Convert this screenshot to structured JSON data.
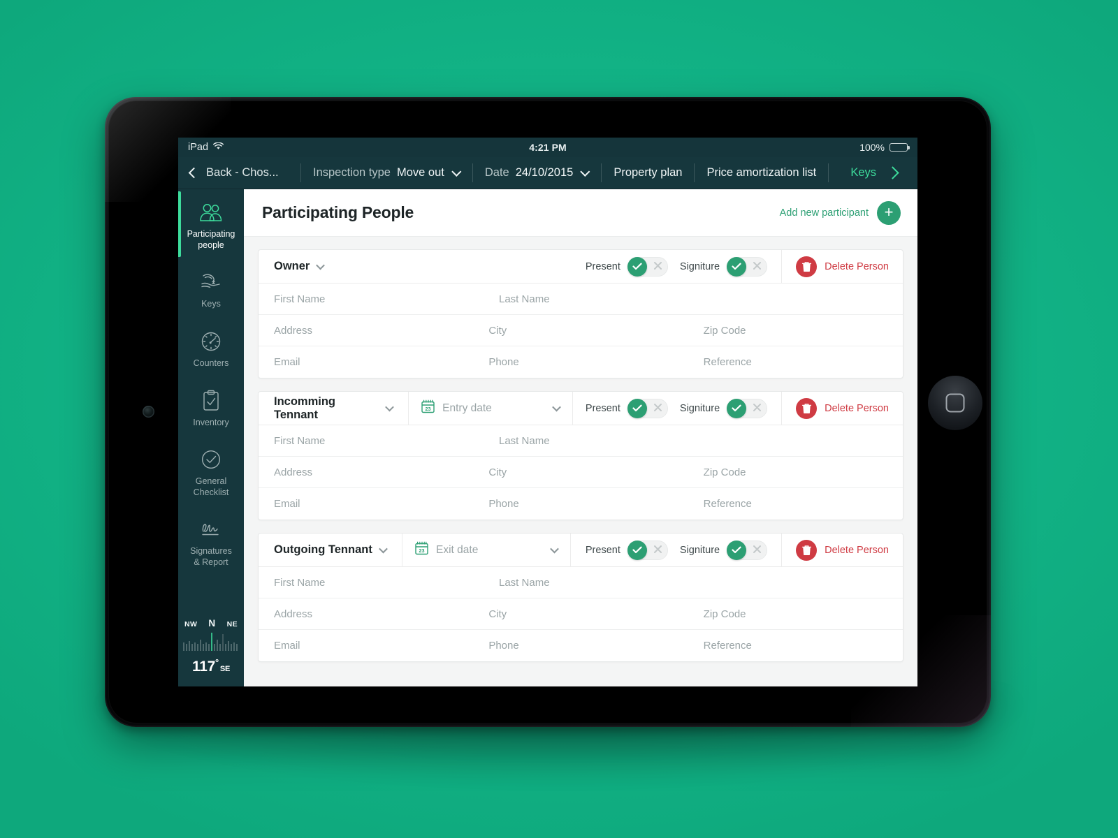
{
  "status_bar": {
    "device": "iPad",
    "wifi_icon": "wifi-icon",
    "time": "4:21 PM",
    "battery_percent": "100%"
  },
  "nav_bar": {
    "back_label": "Back - Chos...",
    "inspection_type_label": "Inspection type",
    "inspection_type_value": "Move out",
    "date_label": "Date",
    "date_value": "24/10/2015",
    "property_plan": "Property plan",
    "price_amortization": "Price amortization list",
    "keys_link": "Keys"
  },
  "sidebar": {
    "items": [
      {
        "label_line1": "Participating",
        "label_line2": "people",
        "icon": "people-icon",
        "active": true
      },
      {
        "label_line1": "Keys",
        "label_line2": "",
        "icon": "hand-key-icon",
        "active": false
      },
      {
        "label_line1": "Counters",
        "label_line2": "",
        "icon": "gauge-icon",
        "active": false
      },
      {
        "label_line1": "Inventory",
        "label_line2": "",
        "icon": "clipboard-check-icon",
        "active": false
      },
      {
        "label_line1": "General",
        "label_line2": "Checklist",
        "icon": "check-circle-icon",
        "active": false
      },
      {
        "label_line1": "Signatures",
        "label_line2": "& Report",
        "icon": "signature-icon",
        "active": false
      }
    ],
    "compass": {
      "left_dir": "NW",
      "center_dir": "N",
      "right_dir": "NE",
      "heading": "117",
      "degree_symbol": "°",
      "heading_dir": "SE"
    }
  },
  "main": {
    "title": "Participating People",
    "add_participant_label": "Add new participant",
    "add_participant_icon": "plus-icon",
    "present_label": "Present",
    "signature_label": "Signiture",
    "delete_label": "Delete Person",
    "cards": [
      {
        "role": "Owner",
        "has_date": false,
        "date_placeholder": "",
        "present_on": true,
        "signature_on": true,
        "rows": [
          [
            "First Name",
            "Last Name",
            ""
          ],
          [
            "Address",
            "City",
            "Zip Code"
          ],
          [
            "Email",
            "Phone",
            "Reference"
          ]
        ]
      },
      {
        "role": "Incomming Tennant",
        "has_date": true,
        "date_placeholder": "Entry date",
        "present_on": true,
        "signature_on": true,
        "rows": [
          [
            "First Name",
            "Last Name",
            ""
          ],
          [
            "Address",
            "City",
            "Zip Code"
          ],
          [
            "Email",
            "Phone",
            "Reference"
          ]
        ]
      },
      {
        "role": "Outgoing Tennant",
        "has_date": true,
        "date_placeholder": "Exit date",
        "present_on": true,
        "signature_on": true,
        "rows": [
          [
            "First Name",
            "Last Name",
            ""
          ],
          [
            "Address",
            "City",
            "Zip Code"
          ],
          [
            "Email",
            "Phone",
            "Reference"
          ]
        ]
      }
    ]
  },
  "colors": {
    "backdrop_green": "#12b386",
    "accent_green": "#2c9f73",
    "nav_dark": "#16373d",
    "active_indicator": "#3ddc9c",
    "danger_red": "#cf3b43",
    "content_bg": "#f4f5f5"
  }
}
